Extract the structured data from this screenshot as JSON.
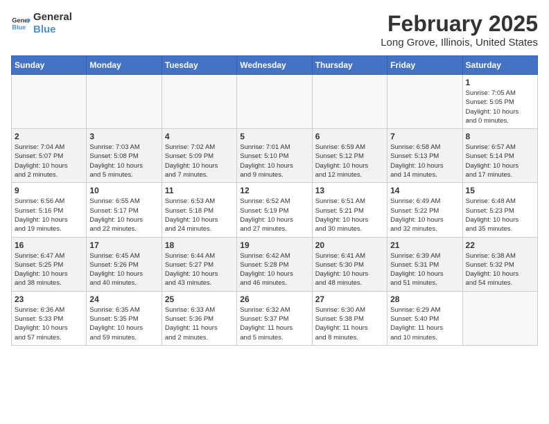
{
  "header": {
    "logo_line1": "General",
    "logo_line2": "Blue",
    "title": "February 2025",
    "subtitle": "Long Grove, Illinois, United States"
  },
  "weekdays": [
    "Sunday",
    "Monday",
    "Tuesday",
    "Wednesday",
    "Thursday",
    "Friday",
    "Saturday"
  ],
  "weeks": [
    [
      {
        "day": "",
        "info": ""
      },
      {
        "day": "",
        "info": ""
      },
      {
        "day": "",
        "info": ""
      },
      {
        "day": "",
        "info": ""
      },
      {
        "day": "",
        "info": ""
      },
      {
        "day": "",
        "info": ""
      },
      {
        "day": "1",
        "info": "Sunrise: 7:05 AM\nSunset: 5:05 PM\nDaylight: 10 hours\nand 0 minutes."
      }
    ],
    [
      {
        "day": "2",
        "info": "Sunrise: 7:04 AM\nSunset: 5:07 PM\nDaylight: 10 hours\nand 2 minutes."
      },
      {
        "day": "3",
        "info": "Sunrise: 7:03 AM\nSunset: 5:08 PM\nDaylight: 10 hours\nand 5 minutes."
      },
      {
        "day": "4",
        "info": "Sunrise: 7:02 AM\nSunset: 5:09 PM\nDaylight: 10 hours\nand 7 minutes."
      },
      {
        "day": "5",
        "info": "Sunrise: 7:01 AM\nSunset: 5:10 PM\nDaylight: 10 hours\nand 9 minutes."
      },
      {
        "day": "6",
        "info": "Sunrise: 6:59 AM\nSunset: 5:12 PM\nDaylight: 10 hours\nand 12 minutes."
      },
      {
        "day": "7",
        "info": "Sunrise: 6:58 AM\nSunset: 5:13 PM\nDaylight: 10 hours\nand 14 minutes."
      },
      {
        "day": "8",
        "info": "Sunrise: 6:57 AM\nSunset: 5:14 PM\nDaylight: 10 hours\nand 17 minutes."
      }
    ],
    [
      {
        "day": "9",
        "info": "Sunrise: 6:56 AM\nSunset: 5:16 PM\nDaylight: 10 hours\nand 19 minutes."
      },
      {
        "day": "10",
        "info": "Sunrise: 6:55 AM\nSunset: 5:17 PM\nDaylight: 10 hours\nand 22 minutes."
      },
      {
        "day": "11",
        "info": "Sunrise: 6:53 AM\nSunset: 5:18 PM\nDaylight: 10 hours\nand 24 minutes."
      },
      {
        "day": "12",
        "info": "Sunrise: 6:52 AM\nSunset: 5:19 PM\nDaylight: 10 hours\nand 27 minutes."
      },
      {
        "day": "13",
        "info": "Sunrise: 6:51 AM\nSunset: 5:21 PM\nDaylight: 10 hours\nand 30 minutes."
      },
      {
        "day": "14",
        "info": "Sunrise: 6:49 AM\nSunset: 5:22 PM\nDaylight: 10 hours\nand 32 minutes."
      },
      {
        "day": "15",
        "info": "Sunrise: 6:48 AM\nSunset: 5:23 PM\nDaylight: 10 hours\nand 35 minutes."
      }
    ],
    [
      {
        "day": "16",
        "info": "Sunrise: 6:47 AM\nSunset: 5:25 PM\nDaylight: 10 hours\nand 38 minutes."
      },
      {
        "day": "17",
        "info": "Sunrise: 6:45 AM\nSunset: 5:26 PM\nDaylight: 10 hours\nand 40 minutes."
      },
      {
        "day": "18",
        "info": "Sunrise: 6:44 AM\nSunset: 5:27 PM\nDaylight: 10 hours\nand 43 minutes."
      },
      {
        "day": "19",
        "info": "Sunrise: 6:42 AM\nSunset: 5:28 PM\nDaylight: 10 hours\nand 46 minutes."
      },
      {
        "day": "20",
        "info": "Sunrise: 6:41 AM\nSunset: 5:30 PM\nDaylight: 10 hours\nand 48 minutes."
      },
      {
        "day": "21",
        "info": "Sunrise: 6:39 AM\nSunset: 5:31 PM\nDaylight: 10 hours\nand 51 minutes."
      },
      {
        "day": "22",
        "info": "Sunrise: 6:38 AM\nSunset: 5:32 PM\nDaylight: 10 hours\nand 54 minutes."
      }
    ],
    [
      {
        "day": "23",
        "info": "Sunrise: 6:36 AM\nSunset: 5:33 PM\nDaylight: 10 hours\nand 57 minutes."
      },
      {
        "day": "24",
        "info": "Sunrise: 6:35 AM\nSunset: 5:35 PM\nDaylight: 10 hours\nand 59 minutes."
      },
      {
        "day": "25",
        "info": "Sunrise: 6:33 AM\nSunset: 5:36 PM\nDaylight: 11 hours\nand 2 minutes."
      },
      {
        "day": "26",
        "info": "Sunrise: 6:32 AM\nSunset: 5:37 PM\nDaylight: 11 hours\nand 5 minutes."
      },
      {
        "day": "27",
        "info": "Sunrise: 6:30 AM\nSunset: 5:38 PM\nDaylight: 11 hours\nand 8 minutes."
      },
      {
        "day": "28",
        "info": "Sunrise: 6:29 AM\nSunset: 5:40 PM\nDaylight: 11 hours\nand 10 minutes."
      },
      {
        "day": "",
        "info": ""
      }
    ]
  ]
}
